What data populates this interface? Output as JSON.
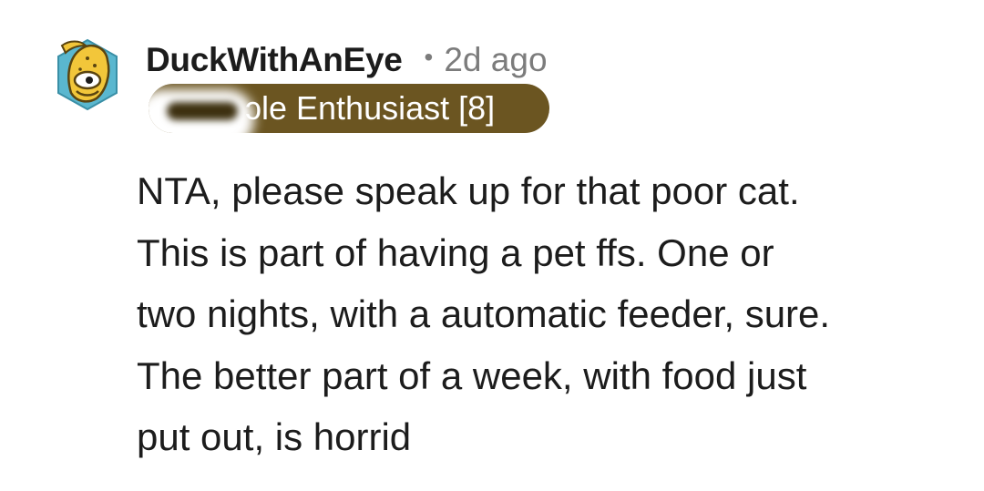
{
  "comment": {
    "author": {
      "username": "DuckWithAnEye",
      "avatar_icon": "yellow-creature-avatar-icon"
    },
    "separator": "•",
    "timestamp": "2d ago",
    "flair": {
      "text": "ɔle Enthusiast [8]",
      "background_color": "#6b5521",
      "text_color": "#ffffff"
    },
    "body_lines": [
      "NTA, please speak up for that poor cat.",
      "This is part of having a pet ffs. One or",
      "two nights, with a automatic feeder, sure.",
      "The better part of a week, with food just",
      "put out, is horrid"
    ]
  }
}
